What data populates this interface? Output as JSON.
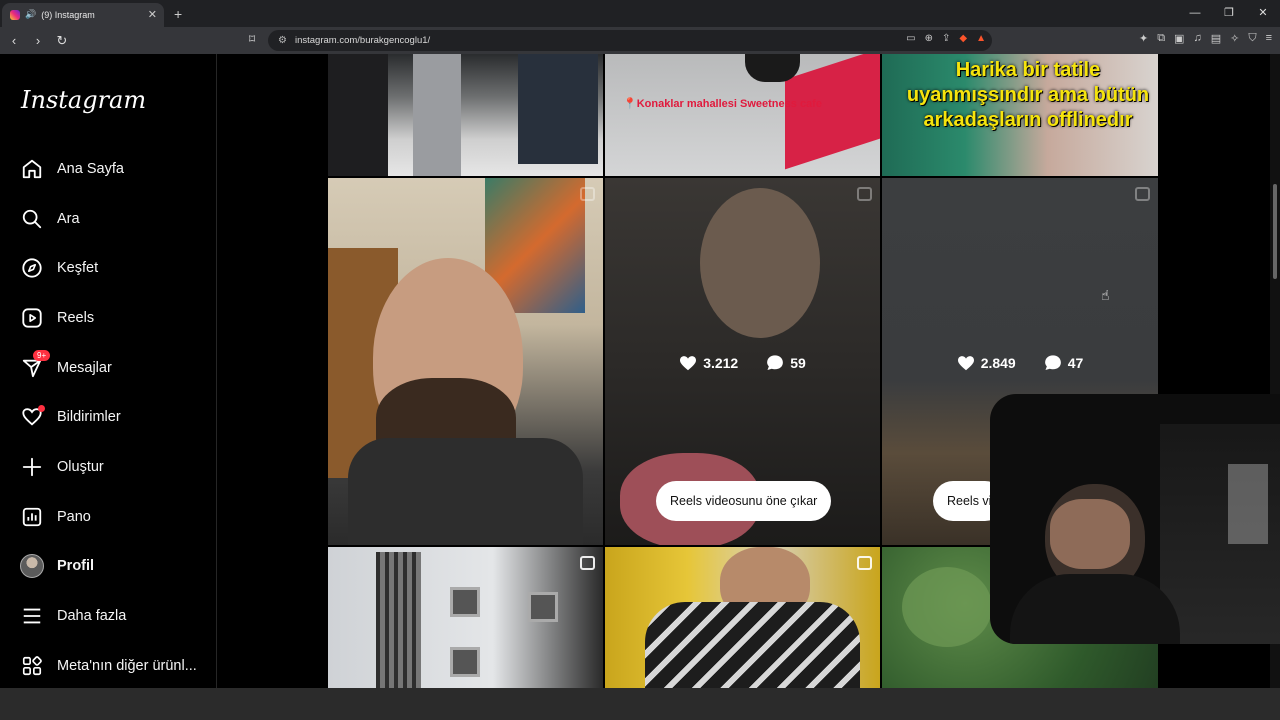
{
  "browser": {
    "tab_title": "(9) Instagram",
    "url": "instagram.com/burakgencoglu1/"
  },
  "sidebar": {
    "logo": "Instagram",
    "items": [
      {
        "label": "Ana Sayfa",
        "icon": "home-icon"
      },
      {
        "label": "Ara",
        "icon": "search-icon"
      },
      {
        "label": "Keşfet",
        "icon": "explore-icon"
      },
      {
        "label": "Reels",
        "icon": "reels-icon"
      },
      {
        "label": "Mesajlar",
        "icon": "messenger-icon",
        "badge": "9+"
      },
      {
        "label": "Bildirimler",
        "icon": "heart-icon"
      },
      {
        "label": "Oluştur",
        "icon": "plus-icon"
      },
      {
        "label": "Pano",
        "icon": "dashboard-icon"
      },
      {
        "label": "Profil",
        "icon": "avatar"
      },
      {
        "label": "Daha fazla",
        "icon": "menu-icon"
      },
      {
        "label": "Meta'nın diğer ürünl...",
        "icon": "apps-icon"
      }
    ]
  },
  "grid": {
    "top_tiles": [
      {
        "caption": ""
      },
      {
        "caption": "📍Konaklar mahallesi Sweetness cafe"
      },
      {
        "caption": "Harika bir tatile uyanmışsındır ama bütün arkadaşların offlinedır"
      }
    ],
    "middle_tiles": [
      {
        "likes": "",
        "comments": ""
      },
      {
        "likes": "3.212",
        "comments": "59",
        "action": "Reels videosunu öne çıkar"
      },
      {
        "likes": "2.849",
        "comments": "47",
        "action": "Reels vi"
      }
    ]
  },
  "colors": {
    "accent_red": "#ff3040",
    "background": "#000000"
  }
}
